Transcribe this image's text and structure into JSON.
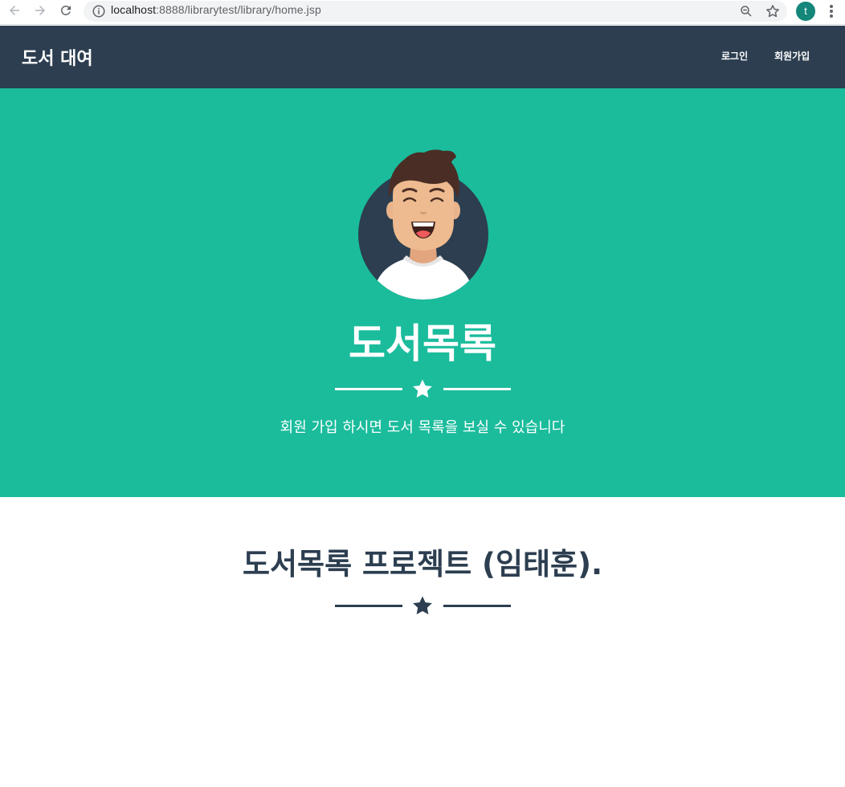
{
  "browser": {
    "url_host": "localhost",
    "url_rest": ":8888/librarytest/library/home.jsp",
    "profile_initial": "t",
    "icons": [
      "back-icon",
      "forward-icon",
      "reload-icon",
      "info-icon",
      "zoom-icon",
      "bookmark-star-icon",
      "menu-icon"
    ]
  },
  "navbar": {
    "brand": "도서 대여",
    "links": [
      {
        "label": "로그인"
      },
      {
        "label": "회원가입"
      }
    ],
    "color": "#2c3e50"
  },
  "masthead": {
    "title": "도서목록",
    "subtitle": "회원 가입 하시면 도서 목록을 보실 수 있습니다",
    "color": "#1abc9c",
    "avatar_icon": "avatar-illustration"
  },
  "section": {
    "title": "도서목록 프로젝트 (임태훈)."
  },
  "colors": {
    "accent": "#1abc9c",
    "dark": "#2c3e50",
    "white": "#ffffff"
  }
}
